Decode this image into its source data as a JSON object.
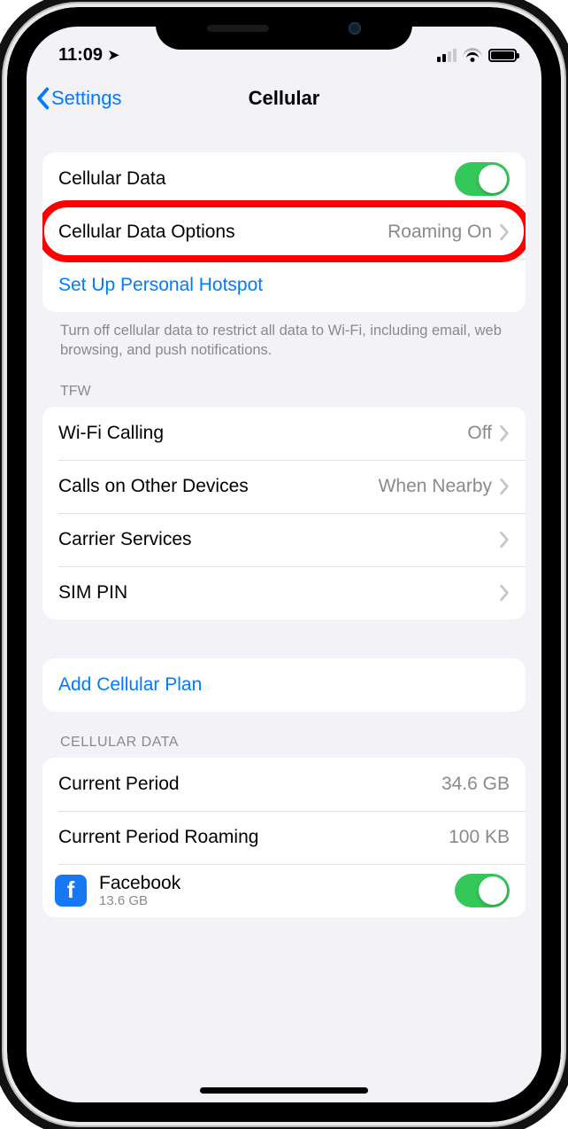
{
  "status": {
    "time": "11:09"
  },
  "nav": {
    "back": "Settings",
    "title": "Cellular"
  },
  "group1": {
    "cellular_data": "Cellular Data",
    "options_label": "Cellular Data Options",
    "options_detail": "Roaming On",
    "hotspot": "Set Up Personal Hotspot",
    "footer": "Turn off cellular data to restrict all data to Wi-Fi, including email, web browsing, and push notifications."
  },
  "carrier": {
    "header": "TFW",
    "wifi_calling_label": "Wi-Fi Calling",
    "wifi_calling_detail": "Off",
    "calls_other_label": "Calls on Other Devices",
    "calls_other_detail": "When Nearby",
    "carrier_services": "Carrier Services",
    "sim_pin": "SIM PIN"
  },
  "plan": {
    "add": "Add Cellular Plan"
  },
  "usage": {
    "header": "CELLULAR DATA",
    "current_label": "Current Period",
    "current_value": "34.6 GB",
    "roaming_label": "Current Period Roaming",
    "roaming_value": "100 KB",
    "app_name": "Facebook",
    "app_usage": "13.6 GB"
  }
}
